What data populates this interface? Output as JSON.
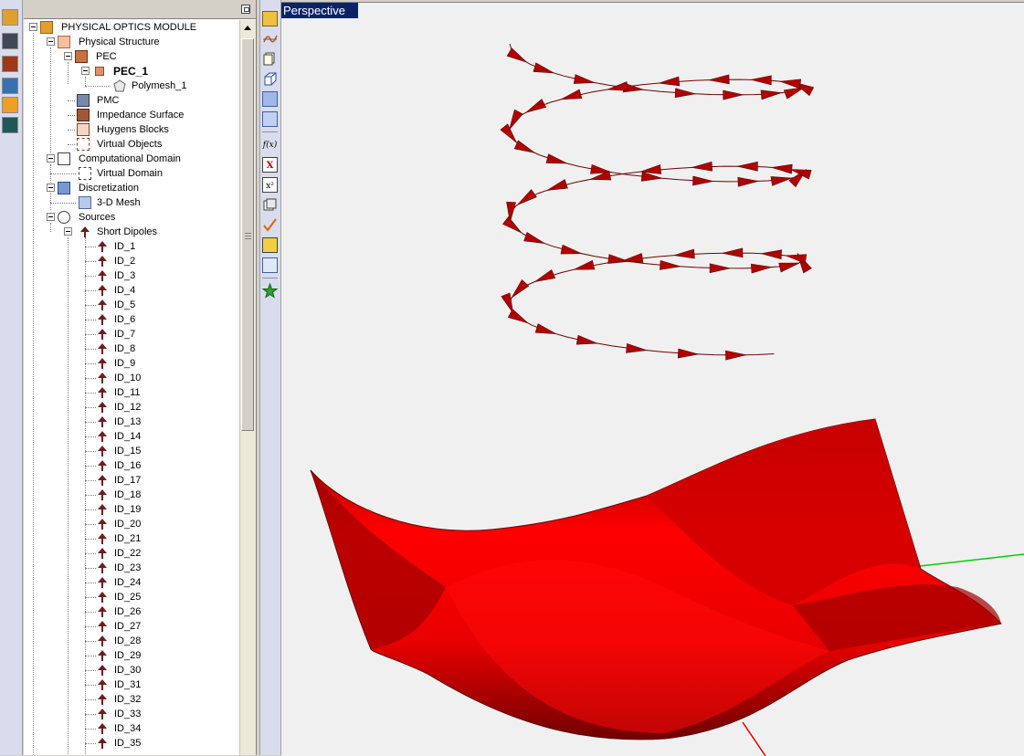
{
  "tree": {
    "root": "PHYSICAL OPTICS MODULE",
    "physical_structure": "Physical Structure",
    "pec": "PEC",
    "pec_1": "PEC_1",
    "polymesh_1": "Polymesh_1",
    "pmc": "PMC",
    "impedance_surface": "Impedance Surface",
    "huygens_blocks": "Huygens Blocks",
    "virtual_objects": "Virtual Objects",
    "computational_domain": "Computational Domain",
    "virtual_domain": "Virtual Domain",
    "discretization": "Discretization",
    "mesh_3d": "3-D Mesh",
    "sources": "Sources",
    "short_dipoles": "Short Dipoles",
    "dipoles": [
      "ID_1",
      "ID_2",
      "ID_3",
      "ID_4",
      "ID_5",
      "ID_6",
      "ID_7",
      "ID_8",
      "ID_9",
      "ID_10",
      "ID_11",
      "ID_12",
      "ID_13",
      "ID_14",
      "ID_15",
      "ID_16",
      "ID_17",
      "ID_18",
      "ID_19",
      "ID_20",
      "ID_21",
      "ID_22",
      "ID_23",
      "ID_24",
      "ID_25",
      "ID_26",
      "ID_27",
      "ID_28",
      "ID_29",
      "ID_30",
      "ID_31",
      "ID_32",
      "ID_33",
      "ID_34",
      "ID_35"
    ]
  },
  "toolbar": {
    "fx_label": "f(x)",
    "x_label": "X",
    "x2_label": "x²"
  },
  "viewport": {
    "title": "Perspective",
    "surface_color": "#e00000",
    "arrow_color": "#b00000",
    "axis_green": "#00d000",
    "axis_red": "#e00000"
  }
}
